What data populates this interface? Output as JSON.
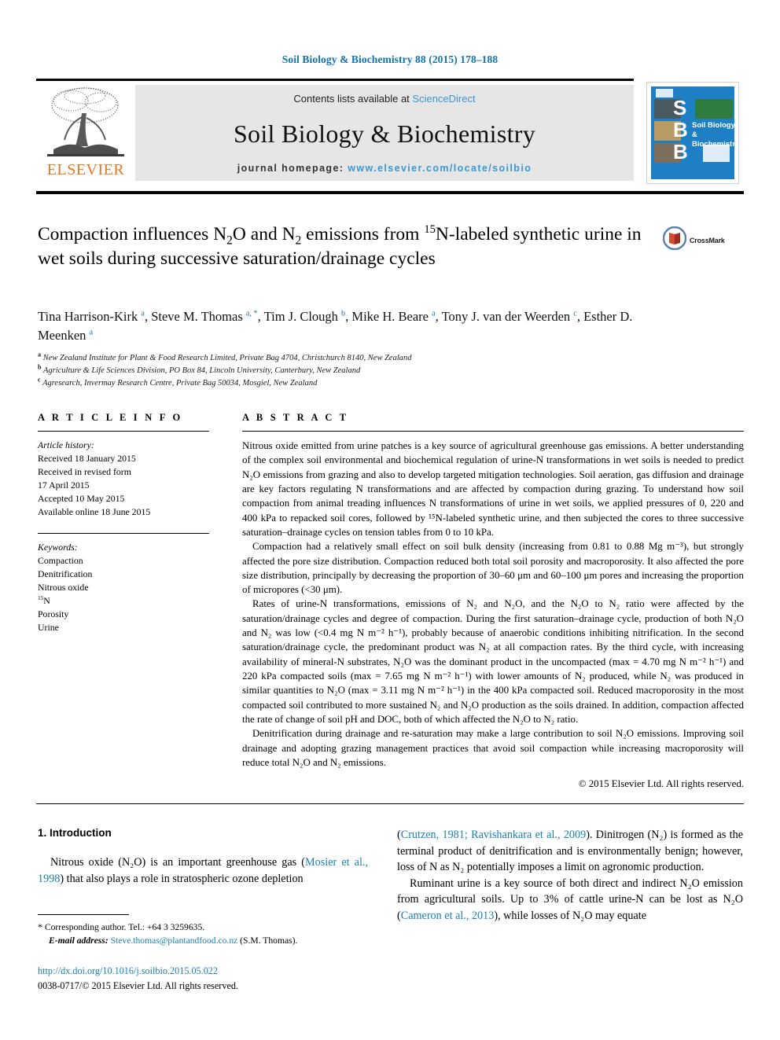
{
  "running_head": "Soil Biology & Biochemistry 88 (2015) 178–188",
  "masthead": {
    "contents_prefix": "Contents lists available at ",
    "sciencedirect": "ScienceDirect",
    "journal_name": "Soil Biology & Biochemistry",
    "homepage_label": "journal homepage: ",
    "homepage_url": "www.elsevier.com/locate/soilbio",
    "publisher": "ELSEVIER",
    "publisher_color": "#e87722",
    "link_color": "#3a97d3",
    "band_color": "#e6e6e6"
  },
  "cover": {
    "letters": [
      "S",
      "B",
      "B"
    ],
    "title_line1": "Soil Biology &",
    "title_line2": "Biochemistry",
    "background": "#1f7fc4"
  },
  "crossmark": {
    "label": "CrossMark"
  },
  "title": {
    "part1": "Compaction influences N",
    "sub1": "2",
    "part2": "O and N",
    "sub2": "2",
    "part3": " emissions from ",
    "sup1": "15",
    "part4": "N-labeled synthetic urine in wet soils during successive saturation/drainage cycles"
  },
  "authors": [
    {
      "name": "Tina Harrison-Kirk",
      "marks": "a",
      "sep": ", "
    },
    {
      "name": "Steve M. Thomas",
      "marks": "a, *",
      "sep": ", "
    },
    {
      "name": "Tim J. Clough",
      "marks": "b",
      "sep": ", "
    },
    {
      "name": "Mike H. Beare",
      "marks": "a",
      "sep": ", "
    },
    {
      "name": "Tony J. van der Weerden",
      "marks": "c",
      "sep": ", "
    },
    {
      "name": "Esther D. Meenken",
      "marks": "a",
      "sep": ""
    }
  ],
  "affiliations": [
    {
      "mark": "a",
      "text": "New Zealand Institute for Plant & Food Research Limited, Private Bag 4704, Christchurch 8140, New Zealand"
    },
    {
      "mark": "b",
      "text": "Agriculture & Life Sciences Division, PO Box 84, Lincoln University, Canterbury, New Zealand"
    },
    {
      "mark": "c",
      "text": "Agresearch, Invermay Research Centre, Private Bag 50034, Mosgiel, New Zealand"
    }
  ],
  "article_info": {
    "heading": "A R T I C L E   I N F O",
    "history_label": "Article history:",
    "history": [
      "Received 18 January 2015",
      "Received in revised form",
      "17 April 2015",
      "Accepted 10 May 2015",
      "Available online 18 June 2015"
    ],
    "keywords_label": "Keywords:",
    "keywords": [
      "Compaction",
      "Denitrification",
      "Nitrous oxide",
      "15N",
      "Porosity",
      "Urine"
    ]
  },
  "abstract": {
    "heading": "A B S T R A C T",
    "paragraphs": [
      "Nitrous oxide emitted from urine patches is a key source of agricultural greenhouse gas emissions. A better understanding of the complex soil environmental and biochemical regulation of urine-N transformations in wet soils is needed to predict N₂O emissions from grazing and also to develop targeted mitigation technologies. Soil aeration, gas diffusion and drainage are key factors regulating N transformations and are affected by compaction during grazing. To understand how soil compaction from animal treading influences N transformations of urine in wet soils, we applied pressures of 0, 220 and 400 kPa to repacked soil cores, followed by ¹⁵N-labeled synthetic urine, and then subjected the cores to three successive saturation–drainage cycles on tension tables from 0 to 10 kPa.",
      "Compaction had a relatively small effect on soil bulk density (increasing from 0.81 to 0.88 Mg m⁻³), but strongly affected the pore size distribution. Compaction reduced both total soil porosity and macroporosity. It also affected the pore size distribution, principally by decreasing the proportion of 30–60 μm and 60–100 μm pores and increasing the proportion of micropores (<30 μm).",
      "Rates of urine-N transformations, emissions of N₂ and N₂O, and the N₂O to N₂ ratio were affected by the saturation/drainage cycles and degree of compaction. During the first saturation–drainage cycle, production of both N₂O and N₂ was low (<0.4 mg N m⁻² h⁻¹), probably because of anaerobic conditions inhibiting nitrification. In the second saturation/drainage cycle, the predominant product was N₂ at all compaction rates. By the third cycle, with increasing availability of mineral-N substrates, N₂O was the dominant product in the uncompacted (max = 4.70 mg N m⁻² h⁻¹) and 220 kPa compacted soils (max = 7.65 mg N m⁻² h⁻¹) with lower amounts of N₂ produced, while N₂ was produced in similar quantities to N₂O (max = 3.11 mg N m⁻² h⁻¹) in the 400 kPa compacted soil. Reduced macroporosity in the most compacted soil contributed to more sustained N₂ and N₂O production as the soils drained. In addition, compaction affected the rate of change of soil pH and DOC, both of which affected the N₂O to N₂ ratio.",
      "Denitrification during drainage and re-saturation may make a large contribution to soil N₂O emissions. Improving soil drainage and adopting grazing management practices that avoid soil compaction while increasing macroporosity will reduce total N₂O and N₂ emissions."
    ],
    "copyright": "© 2015 Elsevier Ltd. All rights reserved."
  },
  "introduction": {
    "heading": "1. Introduction",
    "left_paragraph_pre": "Nitrous oxide (N₂O) is an important greenhouse gas (",
    "left_cite1": "Mosier et al., 1998",
    "left_paragraph_post": ") that also plays a role in stratospheric ozone depletion",
    "right_p1_pre": "(",
    "right_cite1": "Crutzen, 1981; Ravishankara et al., 2009",
    "right_p1_post": "). Dinitrogen (N₂) is formed as the terminal product of denitrification and is environmentally benign; however, loss of N as N₂ potentially imposes a limit on agronomic production.",
    "right_p2_pre": "Ruminant urine is a key source of both direct and indirect N₂O emission from agricultural soils. Up to 3% of cattle urine-N can be lost as N₂O (",
    "right_cite2": "Cameron et al., 2013",
    "right_p2_post": "), while losses of N₂O may equate"
  },
  "footnote": {
    "star": "*",
    "corresponding": " Corresponding author. Tel.: +64 3 3259635.",
    "email_label": "E-mail address:",
    "email": "Steve.thomas@plantandfood.co.nz",
    "email_suffix": " (S.M. Thomas)."
  },
  "footer": {
    "doi": "http://dx.doi.org/10.1016/j.soilbio.2015.05.022",
    "issn": "0038-0717/© 2015 Elsevier Ltd. All rights reserved."
  }
}
